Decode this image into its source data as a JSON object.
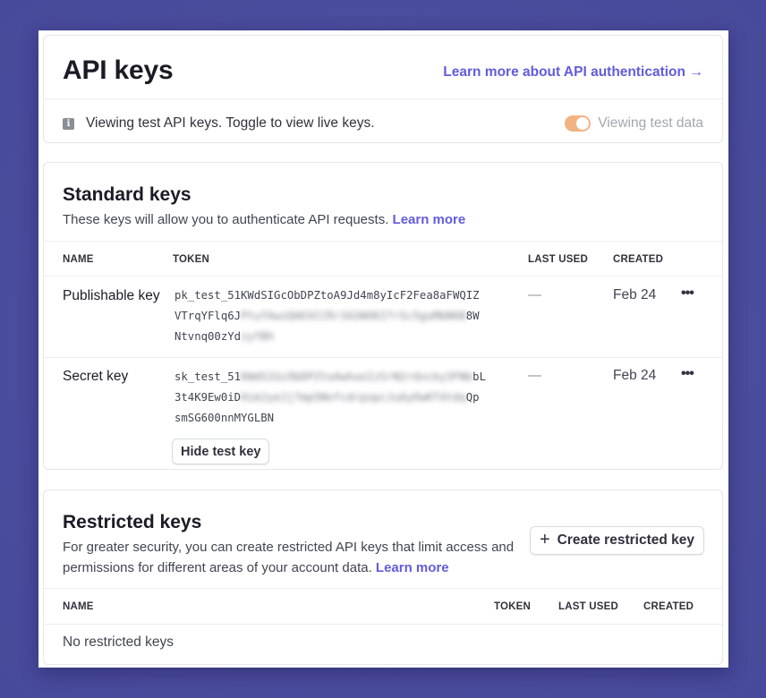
{
  "header": {
    "title": "API keys",
    "auth_link": "Learn more about API authentication",
    "auth_link_icon": "arrow-right-icon",
    "info_icon": "info-icon",
    "info_text": "Viewing test API keys. Toggle to view live keys.",
    "toggle_label": "Viewing test data",
    "toggle_on": true,
    "toggle_color": "#f0a66e"
  },
  "standard": {
    "title": "Standard keys",
    "description": "These keys will allow you to authenticate API requests.",
    "learn_more": "Learn more",
    "columns": [
      "NAME",
      "TOKEN",
      "LAST USED",
      "CREATED"
    ],
    "rows": [
      {
        "name": "Publishable key",
        "token_lines": [
          {
            "visible": "pk_test_51KWdSIGcObDPZtoA9Jd4m8yIcF2Fea8aFWQIZ",
            "blurred": ""
          },
          {
            "visible": "VTrqYFlq6J",
            "blurred": "PtufAwzQAEXCCRr342WXKIfrSc5guMbN6B",
            "tail": "8W"
          },
          {
            "visible": "Ntvnq00zYd",
            "blurred": "zyfBh",
            "tail": ""
          }
        ],
        "last_used": "—",
        "created": "Feb 24",
        "more_icon": "more-horizontal-icon"
      },
      {
        "name": "Secret key",
        "token_lines": [
          {
            "visible": "sk_test_51",
            "blurred": "KWdSIGcObDPZtoAwhuoIzSrN2rdxcky3FNb",
            "tail": "bL"
          },
          {
            "visible": "3t4K9Ew0iD",
            "blurred": "HimJyeJj7mp5NofcdrpopcJuAyOwKT4tdq",
            "tail": "Qp"
          },
          {
            "visible": "smSG600nnMYGLBN",
            "blurred": "",
            "tail": ""
          }
        ],
        "last_used": "—",
        "created": "Feb 24",
        "more_icon": "more-horizontal-icon",
        "hide_button": "Hide test key"
      }
    ]
  },
  "restricted": {
    "title": "Restricted keys",
    "description_line1": "For greater security, you can create restricted API keys that limit access and",
    "description_line2": "permissions for different areas of your account data.",
    "learn_more": "Learn more",
    "create_button": "Create restricted key",
    "create_icon": "plus-icon",
    "columns": [
      "NAME",
      "TOKEN",
      "LAST USED",
      "CREATED"
    ],
    "empty": "No restricted keys"
  },
  "colors": {
    "background": "#4b4e9e",
    "link": "#635bdb",
    "text": "#1a1b25"
  }
}
